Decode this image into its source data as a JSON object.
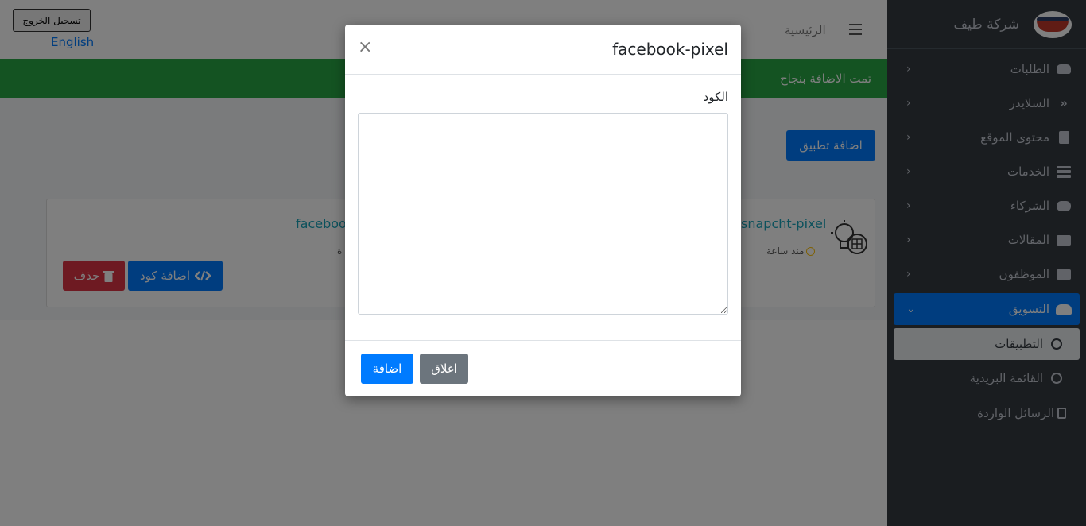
{
  "header": {
    "logout_label": "تسجيل الخروج",
    "language_label": "English",
    "home_label": "الرئيسية"
  },
  "alert": {
    "message": "تمت الاضافة بنجاح"
  },
  "content": {
    "add_app_label": "اضافة تطبيق",
    "apps": [
      {
        "name": "snapcht-pixel",
        "time": "منذ ساعة"
      },
      {
        "name": "faceboo"
      }
    ],
    "add_code_label": "اضافة كود",
    "delete_label": "حذف"
  },
  "sidebar": {
    "brand": "شركة طيف",
    "items": [
      {
        "label": "الطلبات",
        "icon": "car-icon"
      },
      {
        "label": "السلايدر",
        "icon": "angle-double-left-icon"
      },
      {
        "label": "محتوى الموقع",
        "icon": "book-icon"
      },
      {
        "label": "الخدمات",
        "icon": "server-icon"
      },
      {
        "label": "الشركاء",
        "icon": "handshake-icon"
      },
      {
        "label": "المقالات",
        "icon": "newspaper-icon"
      },
      {
        "label": "الموظفون",
        "icon": "newspaper-icon"
      },
      {
        "label": "التسويق",
        "icon": "users-icon",
        "active": true
      }
    ],
    "sub_items": [
      {
        "label": "التطبيقات",
        "current": true
      },
      {
        "label": "القائمة البريدية"
      }
    ],
    "inbox_label": "الرسائل الواردة"
  },
  "modal": {
    "title": "facebook-pixel",
    "close_symbol": "×",
    "field_label": "الكود",
    "code_value": "",
    "add_label": "اضافة",
    "close_label": "اغلاق"
  },
  "colors": {
    "primary": "#007bff",
    "success": "#28a745",
    "danger": "#dc3545",
    "secondary": "#6c757d",
    "sidebar": "#343a40"
  }
}
